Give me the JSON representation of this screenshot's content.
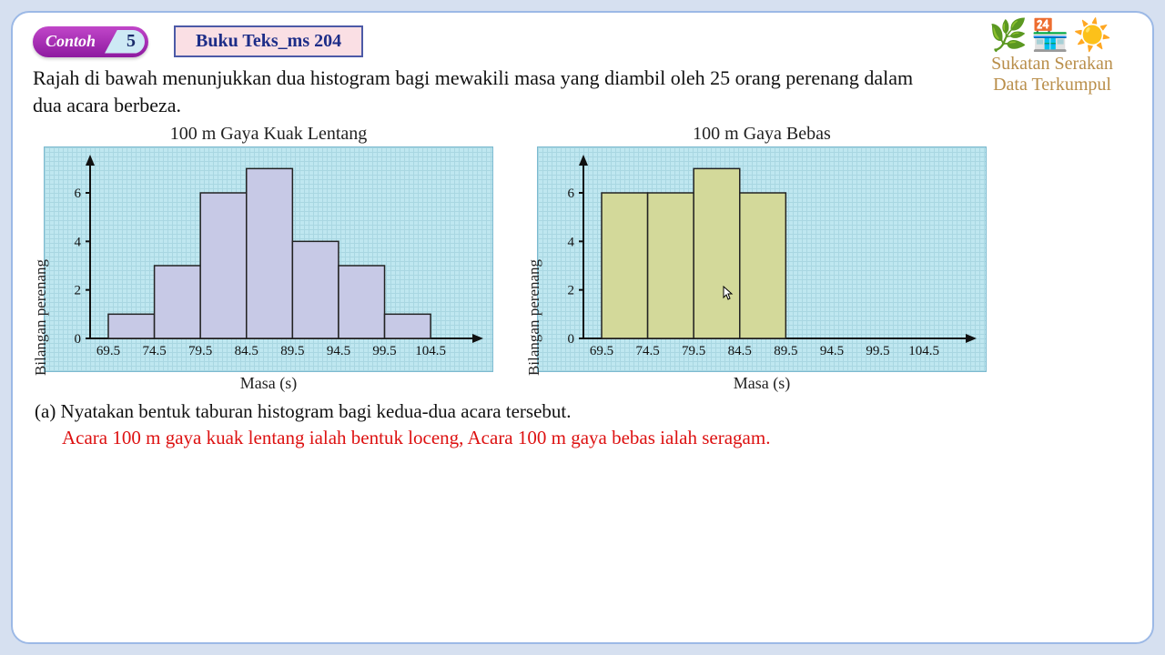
{
  "header": {
    "contoh_label": "Contoh",
    "contoh_num": "5",
    "buku": "Buku Teks_ms 204"
  },
  "deco": {
    "line1": "Sukatan Serakan",
    "line2": "Data Terkumpul"
  },
  "question": "Rajah di bawah menunjukkan dua histogram bagi mewakili masa yang diambil oleh 25 orang perenang dalam dua acara berbeza.",
  "sub_q": "(a) Nyatakan bentuk taburan histogram bagi kedua-dua acara tersebut.",
  "answer": "Acara 100 m gaya kuak lentang ialah bentuk loceng, Acara 100 m gaya bebas ialah seragam.",
  "chart_data": [
    {
      "type": "bar",
      "title": "100 m Gaya Kuak Lentang",
      "xlabel": "Masa (s)",
      "ylabel": "Bilangan perenang",
      "categories": [
        "69.5",
        "74.5",
        "79.5",
        "84.5",
        "89.5",
        "94.5",
        "99.5",
        "104.5"
      ],
      "values": [
        1,
        3,
        6,
        7,
        4,
        3,
        1
      ],
      "yticks": [
        0,
        2,
        4,
        6
      ],
      "ylim": [
        0,
        7.5
      ]
    },
    {
      "type": "bar",
      "title": "100 m Gaya Bebas",
      "xlabel": "Masa (s)",
      "ylabel": "Bilangan perenang",
      "categories": [
        "69.5",
        "74.5",
        "79.5",
        "84.5",
        "89.5",
        "94.5",
        "99.5",
        "104.5"
      ],
      "values": [
        6,
        6,
        7,
        6,
        0,
        0,
        0
      ],
      "yticks": [
        0,
        2,
        4,
        6
      ],
      "ylim": [
        0,
        7.5
      ]
    }
  ]
}
